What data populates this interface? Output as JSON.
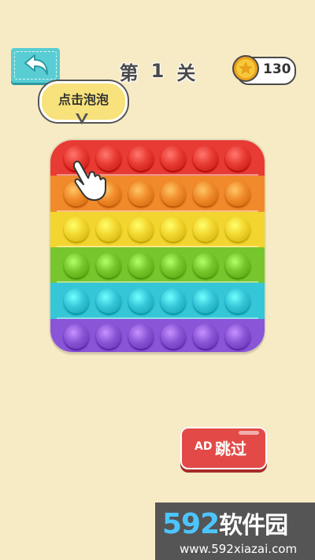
{
  "colors": {
    "background": "#f7ebc6",
    "teal": "#58cdd3",
    "rows": [
      "#e83b33",
      "#f08a2a",
      "#f2d52e",
      "#77c62d",
      "#35c6d8",
      "#8a55d6"
    ]
  },
  "header": {
    "back_icon": "arrow-back-icon",
    "level_prefix": "第",
    "level_number": "1",
    "level_suffix": "关",
    "coins": "130",
    "coin_icon": "coin-star-icon"
  },
  "hint": {
    "text": "点击泡泡"
  },
  "board": {
    "rows": 6,
    "cols": 6
  },
  "actions": {
    "ad_label": "AD",
    "skip_label": "跳过"
  },
  "watermark": {
    "brand_num": "592",
    "brand_cn": "软件园",
    "url": "www.592xiazai.com"
  }
}
